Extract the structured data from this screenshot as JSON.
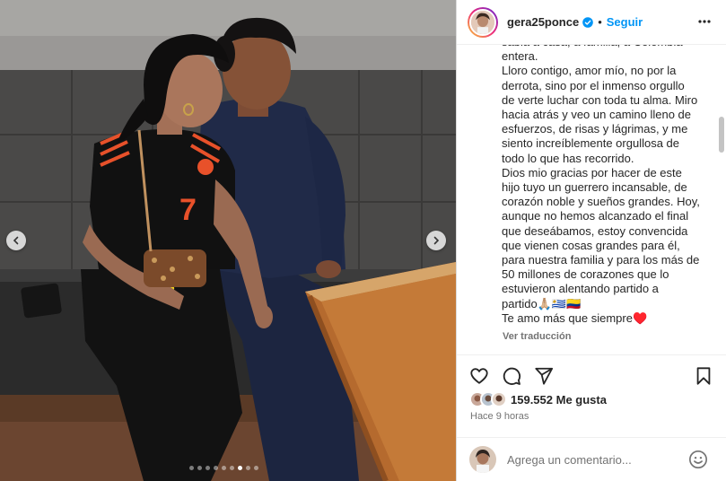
{
  "post": {
    "username": "gera25ponce",
    "separator": "•",
    "follow_label": "Seguir",
    "caption_lines": [
      "sabia a casa, a familia, a Colombia",
      "entera.",
      "Lloro contigo, amor mío, no por la",
      "derrota, sino por el inmenso orgullo",
      "de verte luchar con toda tu alma. Miro",
      "hacia atrás y veo un camino lleno de",
      "esfuerzos, de risas y lágrimas, y me",
      "siento increíblemente orgullosa de",
      "todo lo que has recorrido.",
      "Dios mio gracias por hacer de este",
      "hijo tuyo un guerrero incansable, de",
      "corazón noble y sueños grandes. Hoy,",
      "aunque no hemos alcanzado el final",
      "que deseábamos, estoy convencida",
      "que vienen cosas grandes para él,",
      "para nuestra familia y para los más de",
      "50 millones de corazones que lo",
      "estuvieron alentando partido a",
      "partido🙏🏼🇺🇾🇨🇴",
      "Te amo más que siempre♥️"
    ],
    "translate_label": "Ver traducción",
    "likes_count": "159.552",
    "likes_suffix": " Me gusta",
    "time_ago": "Hace 9 horas",
    "comment_placeholder": "Agrega un comentario...",
    "carousel": {
      "slide_count": 9,
      "active_index": 6
    }
  },
  "icons": {
    "verified": "verified-badge-icon",
    "more": "more-options-icon",
    "like": "heart-icon",
    "comment": "comment-bubble-icon",
    "share": "paper-plane-icon",
    "save": "bookmark-icon",
    "emoji": "smiley-icon",
    "prev": "chevron-left-icon",
    "next": "chevron-right-icon"
  },
  "colors": {
    "accent": "#0095f6",
    "text": "#262626",
    "secondary": "#737373",
    "jersey_black": "#111111",
    "jersey_orange": "#e8512a"
  }
}
